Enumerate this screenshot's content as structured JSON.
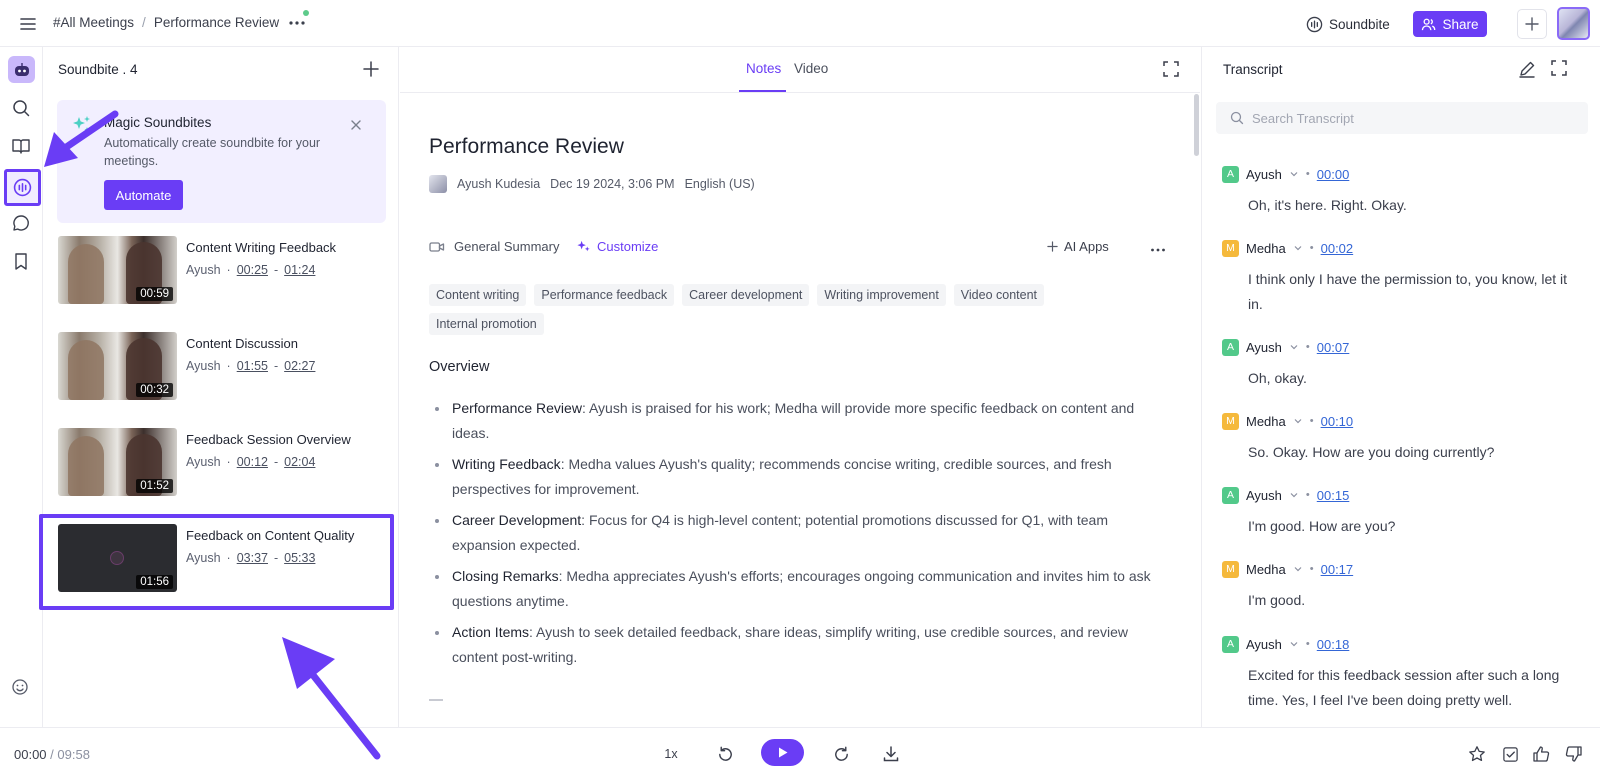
{
  "breadcrumb": {
    "parent": "#All Meetings",
    "separator": "/",
    "current": "Performance Review"
  },
  "topbar": {
    "soundbite_label": "Soundbite",
    "share_label": "Share"
  },
  "soundbites": {
    "title": "Soundbite . 4",
    "magic": {
      "title": "Magic Soundbites",
      "description": "Automatically create soundbite for your meetings.",
      "button": "Automate"
    },
    "items": [
      {
        "name": "Content Writing Feedback",
        "speaker": "Ayush",
        "start": "00:25",
        "end": "01:24",
        "duration": "00:59"
      },
      {
        "name": "Content Discussion",
        "speaker": "Ayush",
        "start": "01:55",
        "end": "02:27",
        "duration": "00:32"
      },
      {
        "name": "Feedback Session Overview",
        "speaker": "Ayush",
        "start": "00:12",
        "end": "02:04",
        "duration": "01:52"
      },
      {
        "name": "Feedback on Content Quality",
        "speaker": "Ayush",
        "start": "03:37",
        "end": "05:33",
        "duration": "01:56"
      }
    ]
  },
  "notes": {
    "tabs": [
      "Notes",
      "Video"
    ],
    "title": "Performance Review",
    "author": "Ayush Kudesia",
    "date": "Dec 19 2024, 3:06 PM",
    "language": "English (US)",
    "toolbar": {
      "summary": "General Summary",
      "customize": "Customize",
      "ai_apps": "AI Apps"
    },
    "tags": [
      "Content writing",
      "Performance feedback",
      "Career development",
      "Writing improvement",
      "Video content",
      "Internal promotion"
    ],
    "overview_heading": "Overview",
    "bullets": [
      {
        "head": "Performance Review",
        "text": ": Ayush is praised for his work; Medha will provide more specific feedback on content and ideas."
      },
      {
        "head": "Writing Feedback",
        "text": ": Medha values Ayush's quality; recommends concise writing, credible sources, and fresh perspectives for improvement."
      },
      {
        "head": "Career Development",
        "text": ": Focus for Q4 is high-level content; potential promotions discussed for Q1, with team expansion expected."
      },
      {
        "head": "Closing Remarks",
        "text": ": Medha appreciates Ayush's efforts; encourages ongoing communication and invites him to ask questions anytime."
      },
      {
        "head": "Action Items",
        "text": ": Ayush to seek detailed feedback, share ideas, simplify writing, use credible sources, and review content post-writing."
      }
    ]
  },
  "transcript": {
    "title": "Transcript",
    "search_placeholder": "Search Transcript",
    "entries": [
      {
        "initial": "A",
        "speaker": "Ayush",
        "time": "00:00",
        "text": "Oh, it's here. Right. Okay."
      },
      {
        "initial": "M",
        "speaker": "Medha",
        "time": "00:02",
        "text": "I think only I have the permission to, you know, let it in."
      },
      {
        "initial": "A",
        "speaker": "Ayush",
        "time": "00:07",
        "text": "Oh, okay."
      },
      {
        "initial": "M",
        "speaker": "Medha",
        "time": "00:10",
        "text": "So. Okay. How are you doing currently?"
      },
      {
        "initial": "A",
        "speaker": "Ayush",
        "time": "00:15",
        "text": "I'm good. How are you?"
      },
      {
        "initial": "M",
        "speaker": "Medha",
        "time": "00:17",
        "text": "I'm good."
      },
      {
        "initial": "A",
        "speaker": "Ayush",
        "time": "00:18",
        "text": "Excited for this feedback session after such a long time. Yes, I feel I've been doing pretty well."
      }
    ]
  },
  "player": {
    "current": "00:00",
    "separator": "/",
    "duration": "09:58",
    "speed": "1x"
  },
  "colors": {
    "accent": "#6a3df5",
    "speaker_a": "#52c98a",
    "speaker_m": "#f5b93c",
    "link": "#3466d6"
  }
}
